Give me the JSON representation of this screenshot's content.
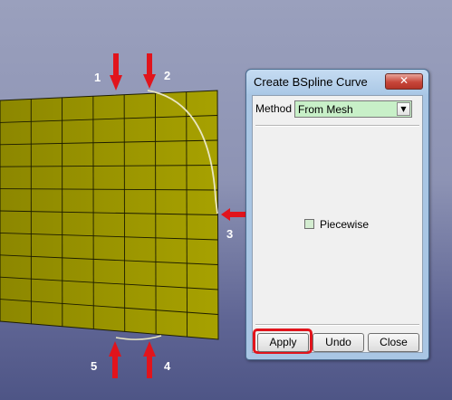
{
  "dialog": {
    "title": "Create BSpline Curve",
    "close_glyph": "✕",
    "method_label": "Method",
    "method_value": "From Mesh",
    "dropdown_arrow": "▼",
    "piecewise_label": "Piecewise",
    "piecewise_checked": false,
    "buttons": {
      "apply": "Apply",
      "undo": "Undo",
      "close": "Close"
    }
  },
  "annotations": {
    "labels": [
      "1",
      "2",
      "3",
      "4",
      "5"
    ],
    "arrow_color": "#e1141c",
    "highlight": "apply-button"
  },
  "colors": {
    "mesh_fill": "#9a9400",
    "mesh_lines": "#1c1c00",
    "curve": "#e9e6c2",
    "dialog_frame": "#a9c6e4",
    "dropdown_bg": "#c8f0c8"
  },
  "icons": [
    "close-icon",
    "chevron-down-icon",
    "red-arrow-icon"
  ]
}
